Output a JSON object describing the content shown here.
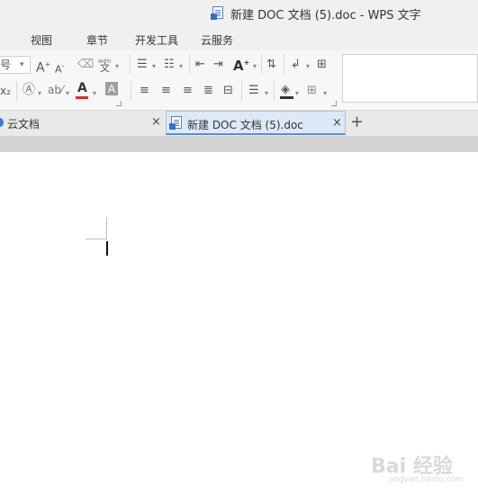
{
  "window": {
    "title": "新建 DOC 文档 (5).doc - WPS 文字"
  },
  "menu": [
    {
      "label": "视图"
    },
    {
      "label": "章节"
    },
    {
      "label": "开发工具"
    },
    {
      "label": "云服务"
    }
  ],
  "ribbon": {
    "font_size_partial": "号",
    "grow_font_label": "A",
    "shrink_font_label": "A",
    "phonetic_label": "wén",
    "phonetic_char": "文",
    "subscript_label": "x₂",
    "font_color_label": "A",
    "highlight_label": "A",
    "text_effect_label": "A"
  },
  "tabs": [
    {
      "label": "云文档"
    },
    {
      "label": "新建 DOC 文档 (5).doc",
      "active": true
    }
  ],
  "tab_close_symbol": "×",
  "add_tab_symbol": "+",
  "watermark": {
    "text": "Bai 经验",
    "sub": "jingyan.baidu.com"
  }
}
